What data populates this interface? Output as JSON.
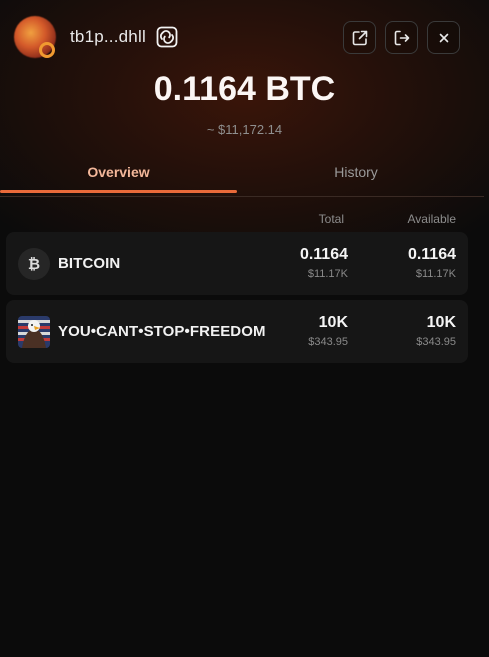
{
  "header": {
    "address": "tb1p...dhll",
    "copy_icon": "copy-icon",
    "buttons": [
      {
        "icon": "external-link-icon"
      },
      {
        "icon": "logout-icon"
      },
      {
        "icon": "close-icon"
      }
    ]
  },
  "balance": {
    "amount": "0.1164 BTC",
    "usd": "~ $11,172.14"
  },
  "tabs": [
    {
      "label": "Overview",
      "active": true
    },
    {
      "label": "History",
      "active": false
    }
  ],
  "columns": {
    "total": "Total",
    "available": "Available"
  },
  "tokens": [
    {
      "icon": "bitcoin-icon",
      "icon_glyph": "₿",
      "name": "BITCOIN",
      "total": "0.1164",
      "total_usd": "$11.17K",
      "available": "0.1164",
      "available_usd": "$11.17K"
    },
    {
      "icon": "rune-eagle-icon",
      "name": "YOU•CANT•STOP•FREEDOM",
      "total": "10K",
      "total_usd": "$343.95",
      "available": "10K",
      "available_usd": "$343.95"
    }
  ],
  "colors": {
    "accent": "#ea6a3a",
    "active_tab_text": "#f3b79a",
    "background": "#0b0b0b",
    "row_background": "#161616"
  }
}
